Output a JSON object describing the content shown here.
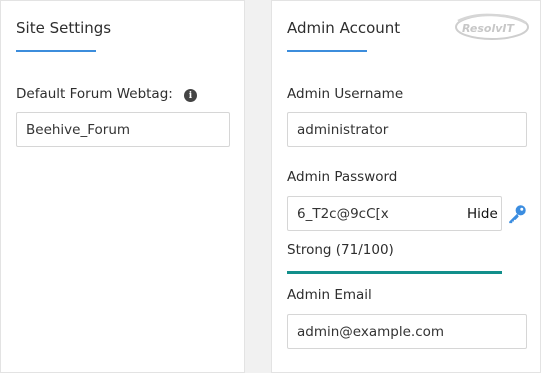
{
  "site_settings": {
    "title": "Site Settings",
    "webtag_label": "Default Forum Webtag:",
    "webtag_value": "Beehive_Forum"
  },
  "admin_account": {
    "title": "Admin Account",
    "username_label": "Admin Username",
    "username_value": "administrator",
    "password_label": "Admin Password",
    "password_value": "6_T2c@9cC[x",
    "hide_label": "Hide",
    "strength_text": "Strong (71/100)",
    "strength_score": 71,
    "strength_max": 100,
    "email_label": "Admin Email",
    "email_value": "admin@example.com"
  },
  "logo": {
    "text": "ResolvIT"
  },
  "colors": {
    "accent_underline": "#3c8ddc",
    "strength_bar": "#128f8b",
    "key_icon": "#3b8de0"
  },
  "icons": {
    "webtag_info": "info-icon",
    "password_key": "key-icon"
  }
}
